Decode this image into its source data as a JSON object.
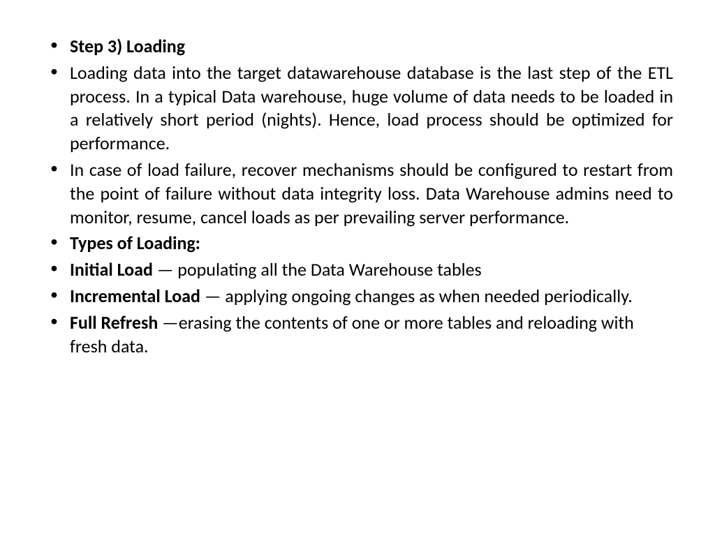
{
  "bullets": [
    {
      "bold": "Step 3) Loading",
      "rest": "",
      "justify": false
    },
    {
      "bold": "",
      "rest": "Loading data into the target datawarehouse database is the last step of the ETL process. In a typical Data warehouse, huge volume of data needs to be loaded in a relatively short period (nights). Hence, load process should be optimized for performance.",
      "justify": true
    },
    {
      "bold": "",
      "rest": "In case of load failure, recover mechanisms should be configured to restart from the point of failure without data integrity loss. Data Warehouse admins need to monitor, resume, cancel loads as per prevailing server performance.",
      "justify": true
    },
    {
      "bold": "Types of Loading:",
      "rest": "",
      "justify": false
    },
    {
      "bold": "Initial Load",
      "rest": " — populating all the Data Warehouse tables",
      "justify": false
    },
    {
      "bold": "Incremental Load",
      "rest": " — applying ongoing changes as when needed periodically.",
      "justify": false
    },
    {
      "bold": "Full Refresh ",
      "rest": " —erasing the contents of one or more tables and reloading with fresh data.",
      "justify": false
    }
  ]
}
